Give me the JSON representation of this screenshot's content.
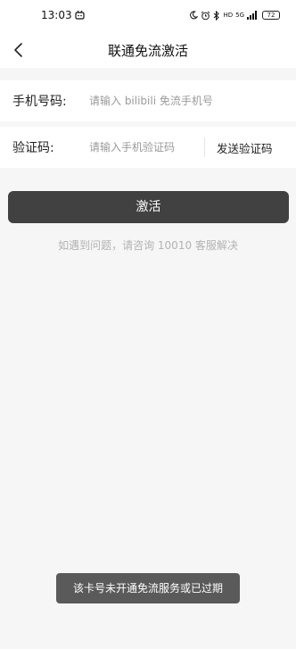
{
  "status_bar": {
    "time": "13:03",
    "network_label": "HD",
    "signal_label": "5G",
    "battery": "72"
  },
  "nav": {
    "title": "联通免流激活",
    "back_icon": "chevron-left-icon"
  },
  "form": {
    "phone_label": "手机号码:",
    "phone_placeholder": "请输入 bilibili 免流手机号",
    "code_label": "验证码:",
    "code_placeholder": "请输入手机验证码",
    "send_code_label": "发送验证码"
  },
  "activate_label": "激活",
  "help_text": "如遇到问题，请咨询 10010 客服解决",
  "toast_text": "该卡号未开通免流服务或已过期",
  "colors": {
    "page_background": "#f6f6f6",
    "button": "#414141",
    "toast": "#5a5a5a",
    "hint": "#b3b3b3"
  }
}
